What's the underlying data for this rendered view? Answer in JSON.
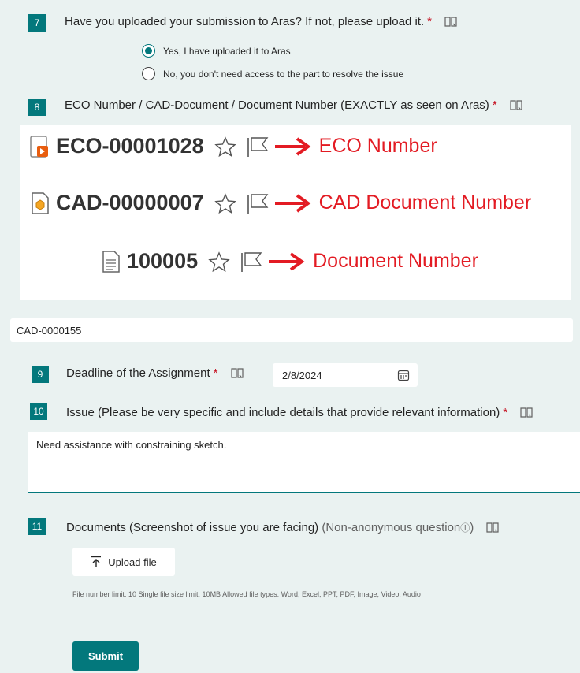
{
  "colors": {
    "accent": "#03787c",
    "required": "#c50f1f",
    "annotation": "#e31b23"
  },
  "q7": {
    "number": "7",
    "title": "Have you uploaded your submission to Aras? If not, please upload it.",
    "required_mark": "*",
    "options": [
      {
        "label": "Yes, I have uploaded it to Aras",
        "selected": true
      },
      {
        "label": "No, you don't need access to the part to resolve the issue",
        "selected": false
      }
    ]
  },
  "q8": {
    "number": "8",
    "title": "ECO Number / CAD-Document / Document Number (EXACTLY as seen on Aras)",
    "required_mark": "*",
    "example_image": {
      "rows": [
        {
          "icon": "eco-document-icon",
          "code": "ECO-00001028",
          "label": "ECO Number"
        },
        {
          "icon": "cad-document-icon",
          "code": "CAD-00000007",
          "label": "CAD Document Number"
        },
        {
          "icon": "document-icon",
          "code": "100005",
          "label": "Document Number"
        }
      ]
    },
    "answer": "CAD-0000155"
  },
  "q9": {
    "number": "9",
    "title": "Deadline of the Assignment",
    "required_mark": "*",
    "date_value": "2/8/2024"
  },
  "q10": {
    "number": "10",
    "title": "Issue (Please be very specific and include details that provide relevant information)",
    "required_mark": "*",
    "answer": "Need assistance with constraining sketch."
  },
  "q11": {
    "number": "11",
    "title": "Documents (Screenshot of issue you are facing)",
    "note": "(Non-anonymous question",
    "info_glyph": "ⓘ",
    "note_close": ")",
    "upload_label": "Upload file",
    "limits": "File number limit: 10   Single file size limit: 10MB   Allowed file types: Word, Excel, PPT, PDF, Image, Video, Audio"
  },
  "submit_label": "Submit"
}
